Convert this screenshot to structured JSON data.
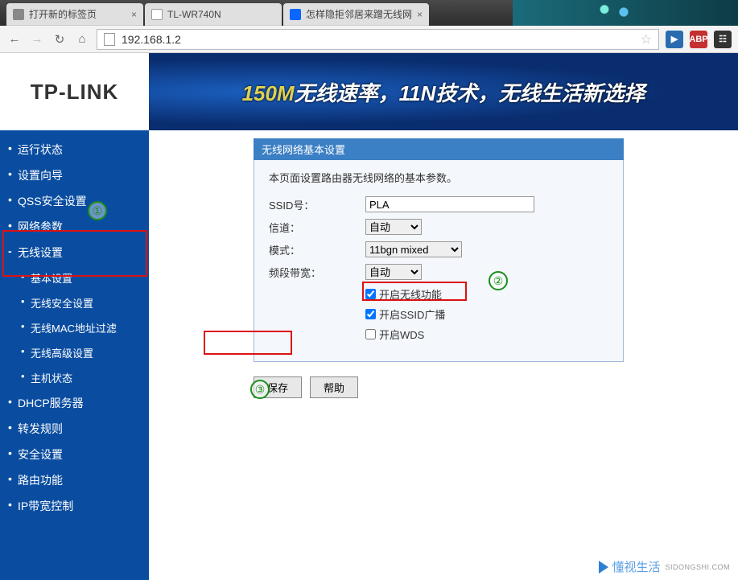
{
  "browser": {
    "tabs": [
      {
        "title": "打开新的标签页"
      },
      {
        "title": "TL-WR740N"
      },
      {
        "title": "怎样隐拒邻居来蹭无线网"
      }
    ],
    "url": "192.168.1.2"
  },
  "banner": {
    "logo": "TP-LINK",
    "slogan_accent": "150M",
    "slogan_rest": "无线速率，11N技术，无线生活新选择"
  },
  "sidebar": {
    "items": [
      {
        "label": "运行状态",
        "sub": false
      },
      {
        "label": "设置向导",
        "sub": false
      },
      {
        "label": "QSS安全设置",
        "sub": false
      },
      {
        "label": "网络参数",
        "sub": false
      },
      {
        "label": "无线设置",
        "sub": false,
        "exp": true
      },
      {
        "label": "基本设置",
        "sub": true
      },
      {
        "label": "无线安全设置",
        "sub": true
      },
      {
        "label": "无线MAC地址过滤",
        "sub": true
      },
      {
        "label": "无线高级设置",
        "sub": true
      },
      {
        "label": "主机状态",
        "sub": true
      },
      {
        "label": "DHCP服务器",
        "sub": false
      },
      {
        "label": "转发规则",
        "sub": false
      },
      {
        "label": "安全设置",
        "sub": false
      },
      {
        "label": "路由功能",
        "sub": false
      },
      {
        "label": "IP带宽控制",
        "sub": false
      }
    ]
  },
  "panel": {
    "title": "无线网络基本设置",
    "desc": "本页面设置路由器无线网络的基本参数。",
    "ssid_label": "SSID号：",
    "ssid_value": "PLA",
    "channel_label": "信道：",
    "channel_value": "自动",
    "mode_label": "模式：",
    "mode_value": "11bgn mixed",
    "bandwidth_label": "频段带宽：",
    "bandwidth_value": "自动",
    "chk_wireless": "开启无线功能",
    "chk_ssid": "开启SSID广播",
    "chk_wds": "开启WDS",
    "btn_save": "保存",
    "btn_help": "帮助"
  },
  "annotations": {
    "a1": "①",
    "a2": "②",
    "a3": "③"
  },
  "watermark": {
    "text": "懂视生活",
    "sub": "SIDONGSHI.COM"
  }
}
